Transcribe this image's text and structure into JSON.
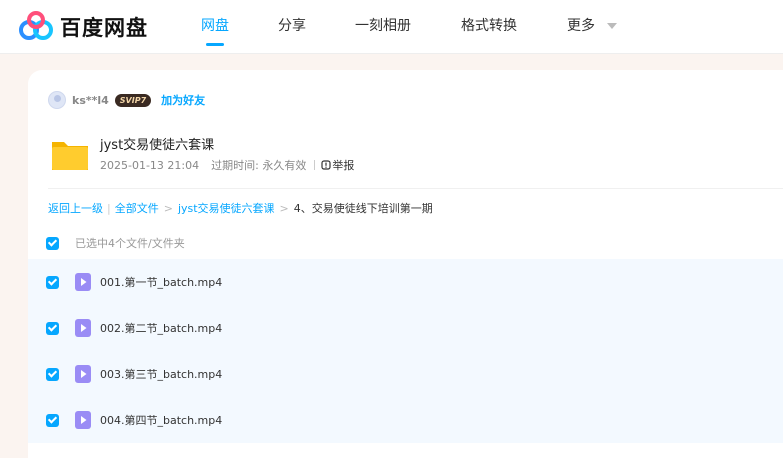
{
  "brand": {
    "name": "百度网盘",
    "accent_color": "#06a7ff"
  },
  "nav": [
    {
      "label": "网盘",
      "active": true
    },
    {
      "label": "分享",
      "active": false
    },
    {
      "label": "一刻相册",
      "active": false
    },
    {
      "label": "格式转换",
      "active": false
    },
    {
      "label": "更多",
      "active": false
    }
  ],
  "sharer": {
    "username": "ks**l4",
    "badge": "SVIP7",
    "add_friend_label": "加为好友"
  },
  "share": {
    "title": "jyst交易使徒六套课",
    "date": "2025-01-13 21:04",
    "expiry_label": "过期时间: 永久有效",
    "report_label": "举报",
    "folder_icon": "folder-icon"
  },
  "breadcrumb": {
    "back": "返回上一级",
    "all_files": "全部文件",
    "level1": "jyst交易使徒六套课",
    "current": "4、交易使徒线下培训第一期"
  },
  "selection": {
    "label": "已选中4个文件/文件夹",
    "checked": true
  },
  "files": [
    {
      "name": "001.第一节_batch.mp4",
      "checked": true,
      "icon": "video-file-icon"
    },
    {
      "name": "002.第二节_batch.mp4",
      "checked": true,
      "icon": "video-file-icon"
    },
    {
      "name": "003.第三节_batch.mp4",
      "checked": true,
      "icon": "video-file-icon"
    },
    {
      "name": "004.第四节_batch.mp4",
      "checked": true,
      "icon": "video-file-icon"
    }
  ]
}
